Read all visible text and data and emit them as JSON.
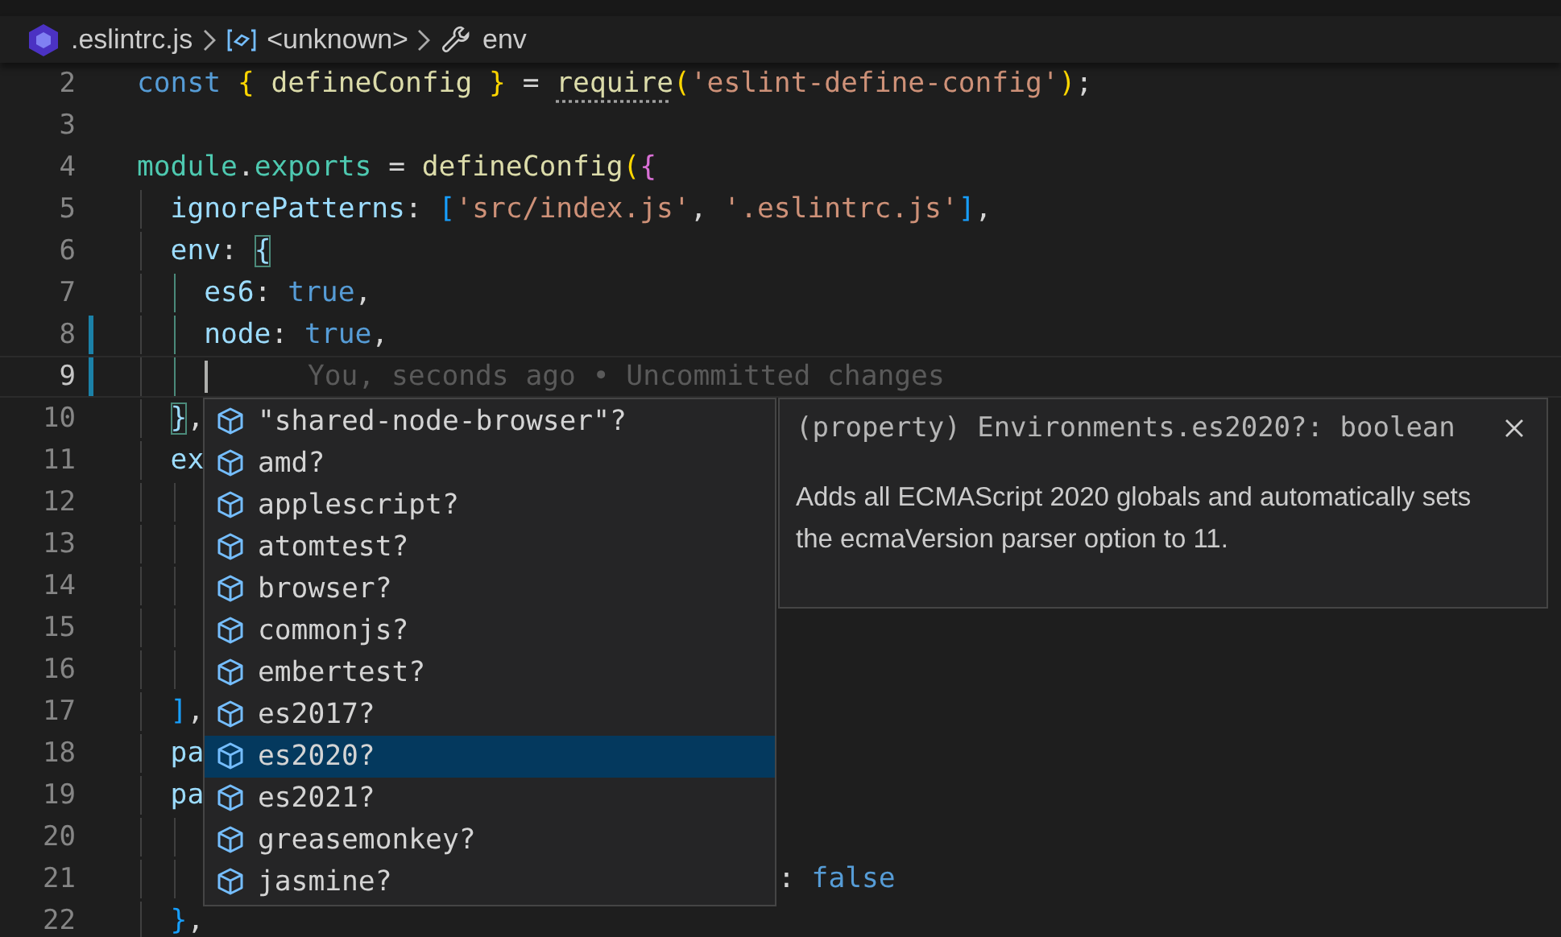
{
  "breadcrumb": [
    {
      "kind": "file",
      "label": ".eslintrc.js"
    },
    {
      "kind": "variable",
      "label": "<unknown>"
    },
    {
      "kind": "property",
      "label": "env"
    }
  ],
  "lines": [
    {
      "number": "2",
      "current": false,
      "modified": false,
      "tokens": [
        {
          "text": "const ",
          "kind": "keyword"
        },
        {
          "text": "{",
          "kind": "brace"
        },
        {
          "text": " defineConfig ",
          "kind": "func"
        },
        {
          "text": "}",
          "kind": "brace"
        },
        {
          "text": " = ",
          "kind": "punct"
        },
        {
          "text": "require",
          "kind": "func-hint"
        },
        {
          "text": "(",
          "kind": "brace"
        },
        {
          "text": "'eslint-define-config'",
          "kind": "string"
        },
        {
          "text": ")",
          "kind": "brace"
        },
        {
          "text": ";",
          "kind": "punct"
        }
      ]
    },
    {
      "number": "3",
      "current": false,
      "modified": false
    },
    {
      "number": "4",
      "current": false,
      "modified": false,
      "tokens": [
        {
          "text": "module",
          "kind": "module"
        },
        {
          "text": ".",
          "kind": "punct"
        },
        {
          "text": "exports",
          "kind": "module"
        },
        {
          "text": " = ",
          "kind": "punct"
        },
        {
          "text": "defineConfig",
          "kind": "func"
        },
        {
          "text": "(",
          "kind": "brace"
        },
        {
          "text": "{",
          "kind": "paren"
        }
      ],
      "children": [
        {
          "number": "5",
          "current": false,
          "modified": false,
          "tokens": [
            {
              "text": "ignorePatterns",
              "kind": "property"
            },
            {
              "text": ": ",
              "kind": "punct"
            },
            {
              "text": "[",
              "kind": "bracket"
            },
            {
              "text": "'src/index.js'",
              "kind": "string"
            },
            {
              "text": ", ",
              "kind": "punct"
            },
            {
              "text": "'.eslintrc.js'",
              "kind": "string"
            },
            {
              "text": "]",
              "kind": "bracket"
            },
            {
              "text": ",",
              "kind": "punct"
            }
          ]
        },
        {
          "number": "6",
          "current": false,
          "modified": false,
          "tokens": [
            {
              "text": "env",
              "kind": "property"
            },
            {
              "text": ": ",
              "kind": "punct"
            },
            {
              "text": "{",
              "kind": "matched"
            }
          ],
          "children": [
            {
              "number": "7",
              "current": false,
              "modified": false,
              "tokens": [
                {
                  "text": "es6",
                  "kind": "property"
                },
                {
                  "text": ": ",
                  "kind": "punct"
                },
                {
                  "text": "true",
                  "kind": "keyword"
                },
                {
                  "text": ",",
                  "kind": "punct"
                }
              ]
            },
            {
              "number": "8",
              "current": false,
              "modified": true,
              "tokens": [
                {
                  "text": "node",
                  "kind": "property"
                },
                {
                  "text": ": ",
                  "kind": "punct"
                },
                {
                  "text": "true",
                  "kind": "keyword"
                },
                {
                  "text": ",",
                  "kind": "punct"
                }
              ]
            },
            {
              "number": "9",
              "current": true,
              "modified": true,
              "tokens": [
                {
                  "text": "You, seconds ago • Uncommitted changes",
                  "kind": "blame"
                }
              ]
            }
          ]
        },
        {
          "number": "10",
          "current": false,
          "modified": false,
          "tokens": [
            {
              "text": "}",
              "kind": "matched"
            },
            {
              "text": ",",
              "kind": "punct"
            }
          ]
        },
        {
          "number": "11",
          "current": false,
          "modified": false,
          "tokens": [
            {
              "text": "ex",
              "kind": "property"
            }
          ],
          "children": [
            {
              "number": "12",
              "current": false,
              "modified": false
            },
            {
              "number": "13",
              "current": false,
              "modified": false
            },
            {
              "number": "14",
              "current": false,
              "modified": false
            },
            {
              "number": "15",
              "current": false,
              "modified": false
            },
            {
              "number": "16",
              "current": false,
              "modified": false
            }
          ]
        },
        {
          "number": "17",
          "current": false,
          "modified": false,
          "tokens": [
            {
              "text": "]",
              "kind": "bracket"
            },
            {
              "text": ",",
              "kind": "punct"
            }
          ]
        },
        {
          "number": "18",
          "current": false,
          "modified": false,
          "tokens": [
            {
              "text": "pa",
              "kind": "property"
            }
          ]
        },
        {
          "number": "19",
          "current": false,
          "modified": false,
          "tokens": [
            {
              "text": "pa",
              "kind": "property"
            }
          ],
          "children": [
            {
              "number": "20",
              "current": false,
              "modified": false
            },
            {
              "number": "21",
              "current": false,
              "modified": false,
              "tokens": [
                {
                  "text": ": ",
                  "kind": "punct",
                  "after_overlay": true
                },
                {
                  "text": "false",
                  "kind": "keyword"
                }
              ]
            }
          ]
        },
        {
          "number": "22",
          "current": false,
          "modified": false,
          "tokens": [
            {
              "text": "}",
              "kind": "bracket"
            },
            {
              "text": ",",
              "kind": "punct"
            }
          ]
        }
      ]
    }
  ],
  "suggestions": [
    {
      "label": "\"shared-node-browser\"?",
      "selected": false
    },
    {
      "label": "amd?",
      "selected": false
    },
    {
      "label": "applescript?",
      "selected": false
    },
    {
      "label": "atomtest?",
      "selected": false
    },
    {
      "label": "browser?",
      "selected": false
    },
    {
      "label": "commonjs?",
      "selected": false
    },
    {
      "label": "embertest?",
      "selected": false
    },
    {
      "label": "es2017?",
      "selected": false
    },
    {
      "label": "es2020?",
      "selected": true
    },
    {
      "label": "es2021?",
      "selected": false
    },
    {
      "label": "greasemonkey?",
      "selected": false
    },
    {
      "label": "jasmine?",
      "selected": false
    }
  ],
  "details": {
    "signature": "(property) Environments.es2020?: boolean",
    "description": "Adds all ECMAScript 2020 globals and automatically sets the ecmaVersion parser option to 11."
  }
}
